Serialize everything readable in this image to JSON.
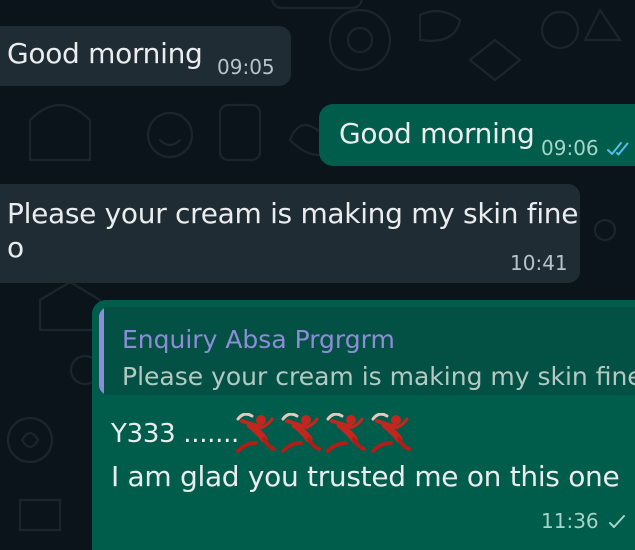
{
  "messages": [
    {
      "direction": "incoming",
      "text": "Good morning",
      "time": "09:05"
    },
    {
      "direction": "outgoing",
      "text": "Good morning",
      "time": "09:06",
      "status": "read",
      "status_icon": "double-check-icon",
      "status_color": "#53bdeb"
    },
    {
      "direction": "incoming",
      "lines": [
        "Please your cream is making my skin fine",
        "o"
      ],
      "time": "10:41"
    },
    {
      "direction": "outgoing",
      "reply_to": {
        "author": "Enquiry Absa Prgrgrm",
        "text": "Please your cream is making my skin fine o"
      },
      "line1_text": "Y333 .......",
      "line1_emojis": [
        "running-man-emoji",
        "running-man-emoji",
        "running-man-emoji",
        "running-man-emoji"
      ],
      "line2_text": "I am glad you trusted me on this one",
      "time": "11:36",
      "status": "sent",
      "status_icon": "single-check-icon"
    }
  ],
  "colors": {
    "wallpaper": "#0b141a",
    "incoming_bubble": "#202c33",
    "outgoing_bubble": "#005c4b",
    "quoted_block": "#025144",
    "quote_author": "#8e8cd8",
    "read_ticks": "#53bdeb"
  }
}
